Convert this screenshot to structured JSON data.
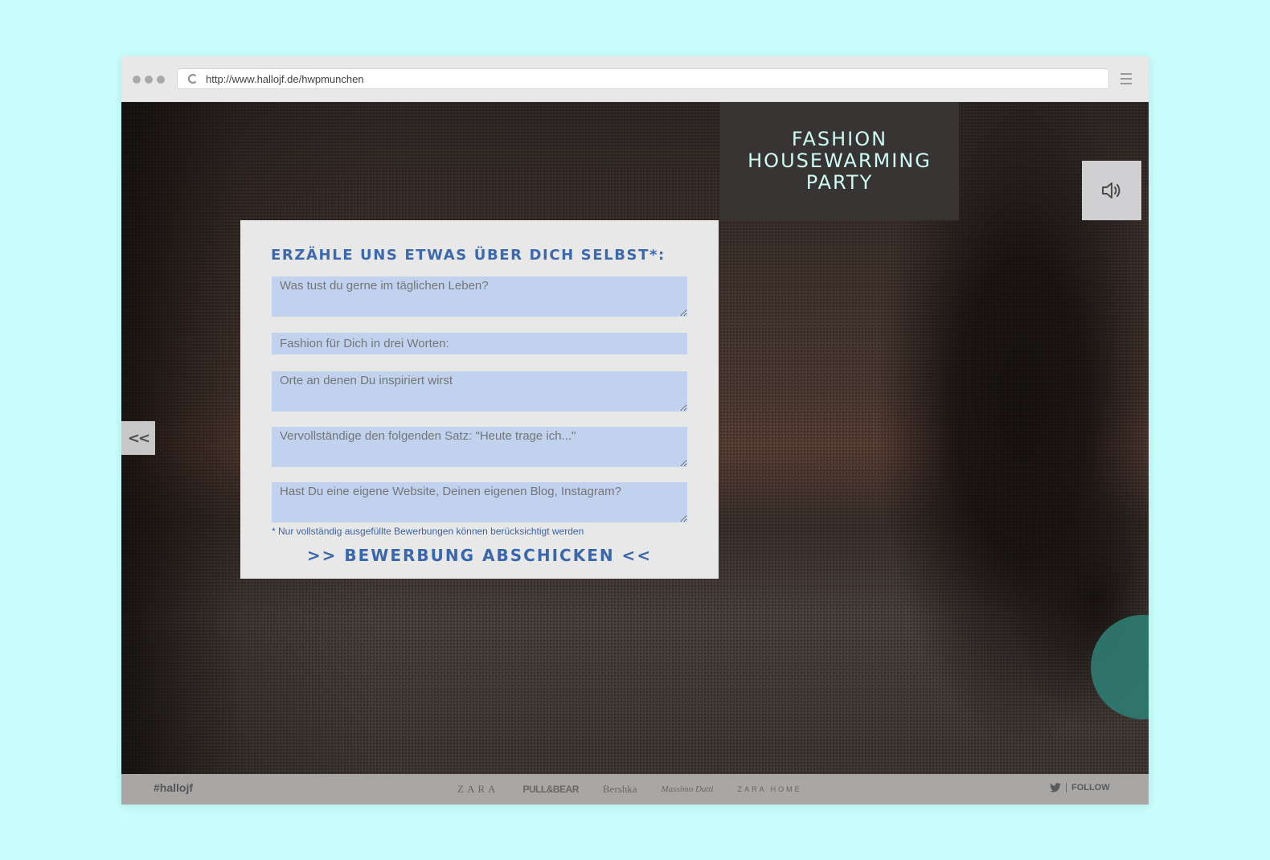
{
  "browser": {
    "url": "http://www.hallojf.de/hwpmunchen"
  },
  "header": {
    "title_lines": [
      "FASHION",
      "HOUSEWARMING",
      "PARTY"
    ]
  },
  "form": {
    "heading": "ERZÄHLE UNS ETWAS ÜBER DICH SELBST*:",
    "fields": [
      {
        "placeholder": "Was tust du gerne im täglichen Leben?"
      },
      {
        "placeholder": "Fashion für Dich in drei Worten:"
      },
      {
        "placeholder": "Orte an denen Du inspiriert wirst"
      },
      {
        "placeholder": "Vervollständige den folgenden Satz: \"Heute trage ich...\""
      },
      {
        "placeholder": "Hast Du eine eigene Website, Deinen eigenen Blog, Instagram?"
      }
    ],
    "note": "* Nur vollständig ausgefüllte Bewerbungen können berücksichtigt werden",
    "submit_label": ">> BEWERBUNG ABSCHICKEN <<"
  },
  "nav": {
    "back_label": "<<",
    "sound_icon": "speaker-icon"
  },
  "footer": {
    "hashtag": "#hallojf",
    "brands": [
      "ZARA",
      "PULL&BEAR",
      "Bershka",
      "Massimo Dutti",
      "ZARA HOME"
    ],
    "follow_label": "FOLLOW",
    "twitter_icon": "twitter-icon"
  },
  "colors": {
    "background": "#c8fdfb",
    "accent_blue": "#3c68ae",
    "field_fill": "#c0d2ee",
    "title_text": "#cdfbf5"
  }
}
